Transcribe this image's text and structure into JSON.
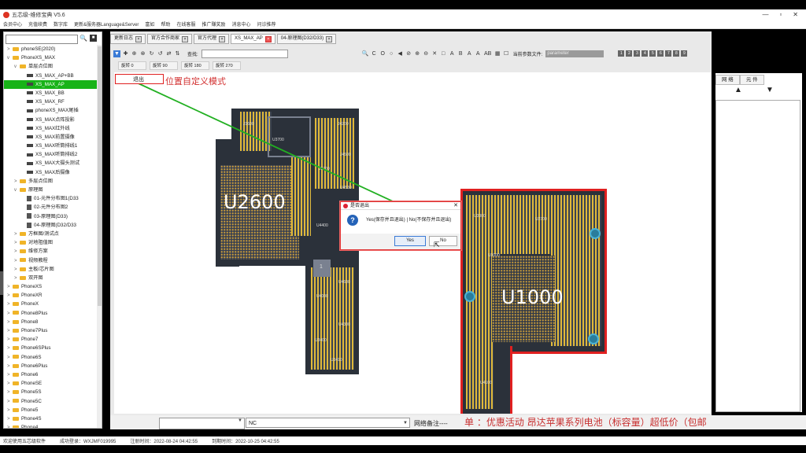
{
  "window": {
    "title": "五芯级-维修宝典 V5.6",
    "controls": [
      "—",
      "▫",
      "✕"
    ]
  },
  "menu": [
    "会员中心",
    "充值续费",
    "数字库",
    "更新&服务器Language&Server",
    "富如",
    "帮助",
    "在线客服",
    "推广赚奖励",
    "消息中心",
    "问诊推荐"
  ],
  "sidebar": {
    "tree": [
      {
        "label": "phoneSE(2020)",
        "level": 1,
        "kind": "folder",
        "arrow": ">"
      },
      {
        "label": "PhoneXS_MAX",
        "level": 1,
        "kind": "folder",
        "arrow": "v"
      },
      {
        "label": "单层点位图",
        "level": 2,
        "kind": "folder",
        "arrow": "v"
      },
      {
        "label": "XS_MAX_AP+BB",
        "level": 3,
        "kind": "pcb"
      },
      {
        "label": "XS_MAX_AP",
        "level": 3,
        "kind": "pcb",
        "selected": true
      },
      {
        "label": "XS_MAX_BB",
        "level": 3,
        "kind": "pcb"
      },
      {
        "label": "XS_MAX_RF",
        "level": 3,
        "kind": "pcb"
      },
      {
        "label": "phoneXS_MAX尾插",
        "level": 3,
        "kind": "pcb"
      },
      {
        "label": "XS_MAX点阵投影",
        "level": 3,
        "kind": "pcb"
      },
      {
        "label": "XS_MAX红外线",
        "level": 3,
        "kind": "pcb"
      },
      {
        "label": "XS_MAX前置摄像",
        "level": 3,
        "kind": "pcb"
      },
      {
        "label": "XS_MAX听筒排线1",
        "level": 3,
        "kind": "pcb"
      },
      {
        "label": "XS_MAX听筒排线2",
        "level": 3,
        "kind": "pcb"
      },
      {
        "label": "XS_MAX大摄头测试",
        "level": 3,
        "kind": "pcb"
      },
      {
        "label": "XS_MAX后摄像",
        "level": 3,
        "kind": "pcb"
      },
      {
        "label": "多层点位图",
        "level": 2,
        "kind": "folder",
        "arrow": ">"
      },
      {
        "label": "原理图",
        "level": 2,
        "kind": "folder",
        "arrow": "v"
      },
      {
        "label": "01-元件分布图1(D33",
        "level": 3,
        "kind": "doc"
      },
      {
        "label": "02-元件分布图2",
        "level": 3,
        "kind": "doc"
      },
      {
        "label": "03-原理图(D33)",
        "level": 3,
        "kind": "doc"
      },
      {
        "label": "04-原理图(D32/D33",
        "level": 3,
        "kind": "doc"
      },
      {
        "label": "方框图/测试点",
        "level": 2,
        "kind": "folder",
        "arrow": ">"
      },
      {
        "label": "对地阻值图",
        "level": 2,
        "kind": "folder",
        "arrow": ">"
      },
      {
        "label": "维修方案",
        "level": 2,
        "kind": "folder",
        "arrow": ">"
      },
      {
        "label": "视频教程",
        "level": 2,
        "kind": "folder",
        "arrow": ">"
      },
      {
        "label": "主板/芯片图",
        "level": 2,
        "kind": "folder",
        "arrow": ">"
      },
      {
        "label": "双开图",
        "level": 2,
        "kind": "folder",
        "arrow": ">"
      },
      {
        "label": "PhoneXS",
        "level": 1,
        "kind": "folder",
        "arrow": ">"
      },
      {
        "label": "PhoneXR",
        "level": 1,
        "kind": "folder",
        "arrow": ">"
      },
      {
        "label": "PhoneX",
        "level": 1,
        "kind": "folder",
        "arrow": ">"
      },
      {
        "label": "Phone8Plus",
        "level": 1,
        "kind": "folder",
        "arrow": ">"
      },
      {
        "label": "Phone8",
        "level": 1,
        "kind": "folder",
        "arrow": ">"
      },
      {
        "label": "Phone7Plus",
        "level": 1,
        "kind": "folder",
        "arrow": ">"
      },
      {
        "label": "Phone7",
        "level": 1,
        "kind": "folder",
        "arrow": ">"
      },
      {
        "label": "Phone6SPlus",
        "level": 1,
        "kind": "folder",
        "arrow": ">"
      },
      {
        "label": "Phone6S",
        "level": 1,
        "kind": "folder",
        "arrow": ">"
      },
      {
        "label": "Phone6Plus",
        "level": 1,
        "kind": "folder",
        "arrow": ">"
      },
      {
        "label": "Phone6",
        "level": 1,
        "kind": "folder",
        "arrow": ">"
      },
      {
        "label": "PhoneSE",
        "level": 1,
        "kind": "folder",
        "arrow": ">"
      },
      {
        "label": "Phone5S",
        "level": 1,
        "kind": "folder",
        "arrow": ">"
      },
      {
        "label": "Phone5C",
        "level": 1,
        "kind": "folder",
        "arrow": ">"
      },
      {
        "label": "Phone5",
        "level": 1,
        "kind": "folder",
        "arrow": ">"
      },
      {
        "label": "Phone4S",
        "level": 1,
        "kind": "folder",
        "arrow": ">"
      },
      {
        "label": "Phone4",
        "level": 1,
        "kind": "folder",
        "arrow": ">"
      }
    ]
  },
  "tabs": [
    {
      "label": "更新日志",
      "active": false
    },
    {
      "label": "官方合作商家",
      "active": false
    },
    {
      "label": "官方代理",
      "active": false
    },
    {
      "label": "XS_MAX_AP",
      "active": true
    },
    {
      "label": "04-原理图(D32/D33)",
      "active": false
    }
  ],
  "toolbar": {
    "find_label": "查找:",
    "param_label": "当前参数文件:",
    "param_value": "parameter",
    "left_icons": [
      "▼",
      "✚",
      "⊕",
      "⊗",
      "↻",
      "↺",
      "⇄",
      "⇅"
    ],
    "right_icons": [
      "🔍",
      "C",
      "O",
      "○",
      "◀",
      "⊘",
      "⊕",
      "⊖",
      "✕",
      "□",
      "A",
      "B",
      "A",
      "A",
      "AB",
      "▦",
      "☐"
    ],
    "layer_buttons": [
      "1",
      "2",
      "3",
      "4",
      "5",
      "6",
      "7",
      "8",
      "9"
    ]
  },
  "rotations": [
    "旋转 0",
    "旋转 90",
    "旋转 180",
    "旋转 270"
  ],
  "canvas": {
    "exit_label": "退出",
    "mode_label": "位置自定义模式",
    "labels_left": [
      "J3600",
      "U3700",
      "J4200",
      "J4500",
      "J5700",
      "U4530",
      "U4400",
      "U4600",
      "U4000",
      "U4300",
      "U3400",
      "U3410"
    ],
    "chip_left": "U2600",
    "chip_right": "U1000",
    "labels_right": [
      "U3300",
      "U2700",
      "U1000",
      "U4100"
    ],
    "small_label": "1"
  },
  "dialog": {
    "title": "是否退出",
    "message": "Yes(保存并且退出) | No(不保存并且退出)",
    "yes": "Yes",
    "no": "No",
    "q": "?"
  },
  "right_panel": {
    "tab_net": "网 络",
    "tab_part": "元 件",
    "up": "▲",
    "down": "▼"
  },
  "bottom": {
    "select_b_value": "NC",
    "net_note_label": "网络备注----",
    "marquee": "单 ：优惠活动 昂达苹果系列电池（标容量）超低价（包邮"
  },
  "status": {
    "welcome": "欢迎使用五芯级软件",
    "login": "成功登录：WXJMF019995",
    "register": "注册时间：2022-08-24 04:42:55",
    "expire": "到期时间：2022-10-25 04:42:55"
  }
}
